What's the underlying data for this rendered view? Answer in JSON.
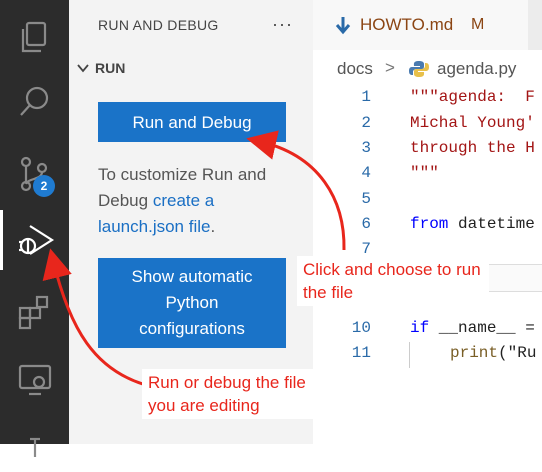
{
  "activity_bar": {
    "items": [
      {
        "name": "explorer-icon"
      },
      {
        "name": "search-icon"
      },
      {
        "name": "source-control-icon",
        "badge": "2"
      },
      {
        "name": "run-debug-icon",
        "active": true
      },
      {
        "name": "extensions-icon"
      },
      {
        "name": "remote-explorer-icon"
      },
      {
        "name": "testing-icon"
      }
    ]
  },
  "sidebar": {
    "title": "RUN AND DEBUG",
    "more": "···",
    "section": "RUN",
    "run_button": "Run and Debug",
    "help_prefix": "To customize Run and Debug ",
    "help_link": "create a launch.json file",
    "help_suffix": ".",
    "show_button": "Show automatic\nPython\nconfigurations"
  },
  "editor": {
    "tab": {
      "label": "HOWTO.md",
      "modified": "M"
    },
    "breadcrumb": {
      "folder": "docs",
      "separator": ">",
      "file": "agenda.py"
    },
    "lines": [
      {
        "n": "1",
        "text": "\"\"\"agenda:  F"
      },
      {
        "n": "2",
        "text": "Michal Young'"
      },
      {
        "n": "3",
        "text": "through the H"
      },
      {
        "n": "4",
        "text": "\"\"\""
      },
      {
        "n": "5",
        "text": ""
      },
      {
        "n": "6",
        "kw": "from",
        "rest": " datetime"
      },
      {
        "n": "7",
        "text": ""
      },
      {
        "n": "10",
        "kw": "if",
        "rest": " __name__ ="
      },
      {
        "n": "11",
        "fn": "print",
        "rest": "(\"Ru"
      }
    ]
  },
  "annotations": {
    "click_note": "Click and choose to run the file",
    "run_note": "Run or debug the file you are editing"
  },
  "colors": {
    "accent": "#1a73c8",
    "annotation": "#e8261c",
    "activity_bg": "#2c2c2c"
  }
}
